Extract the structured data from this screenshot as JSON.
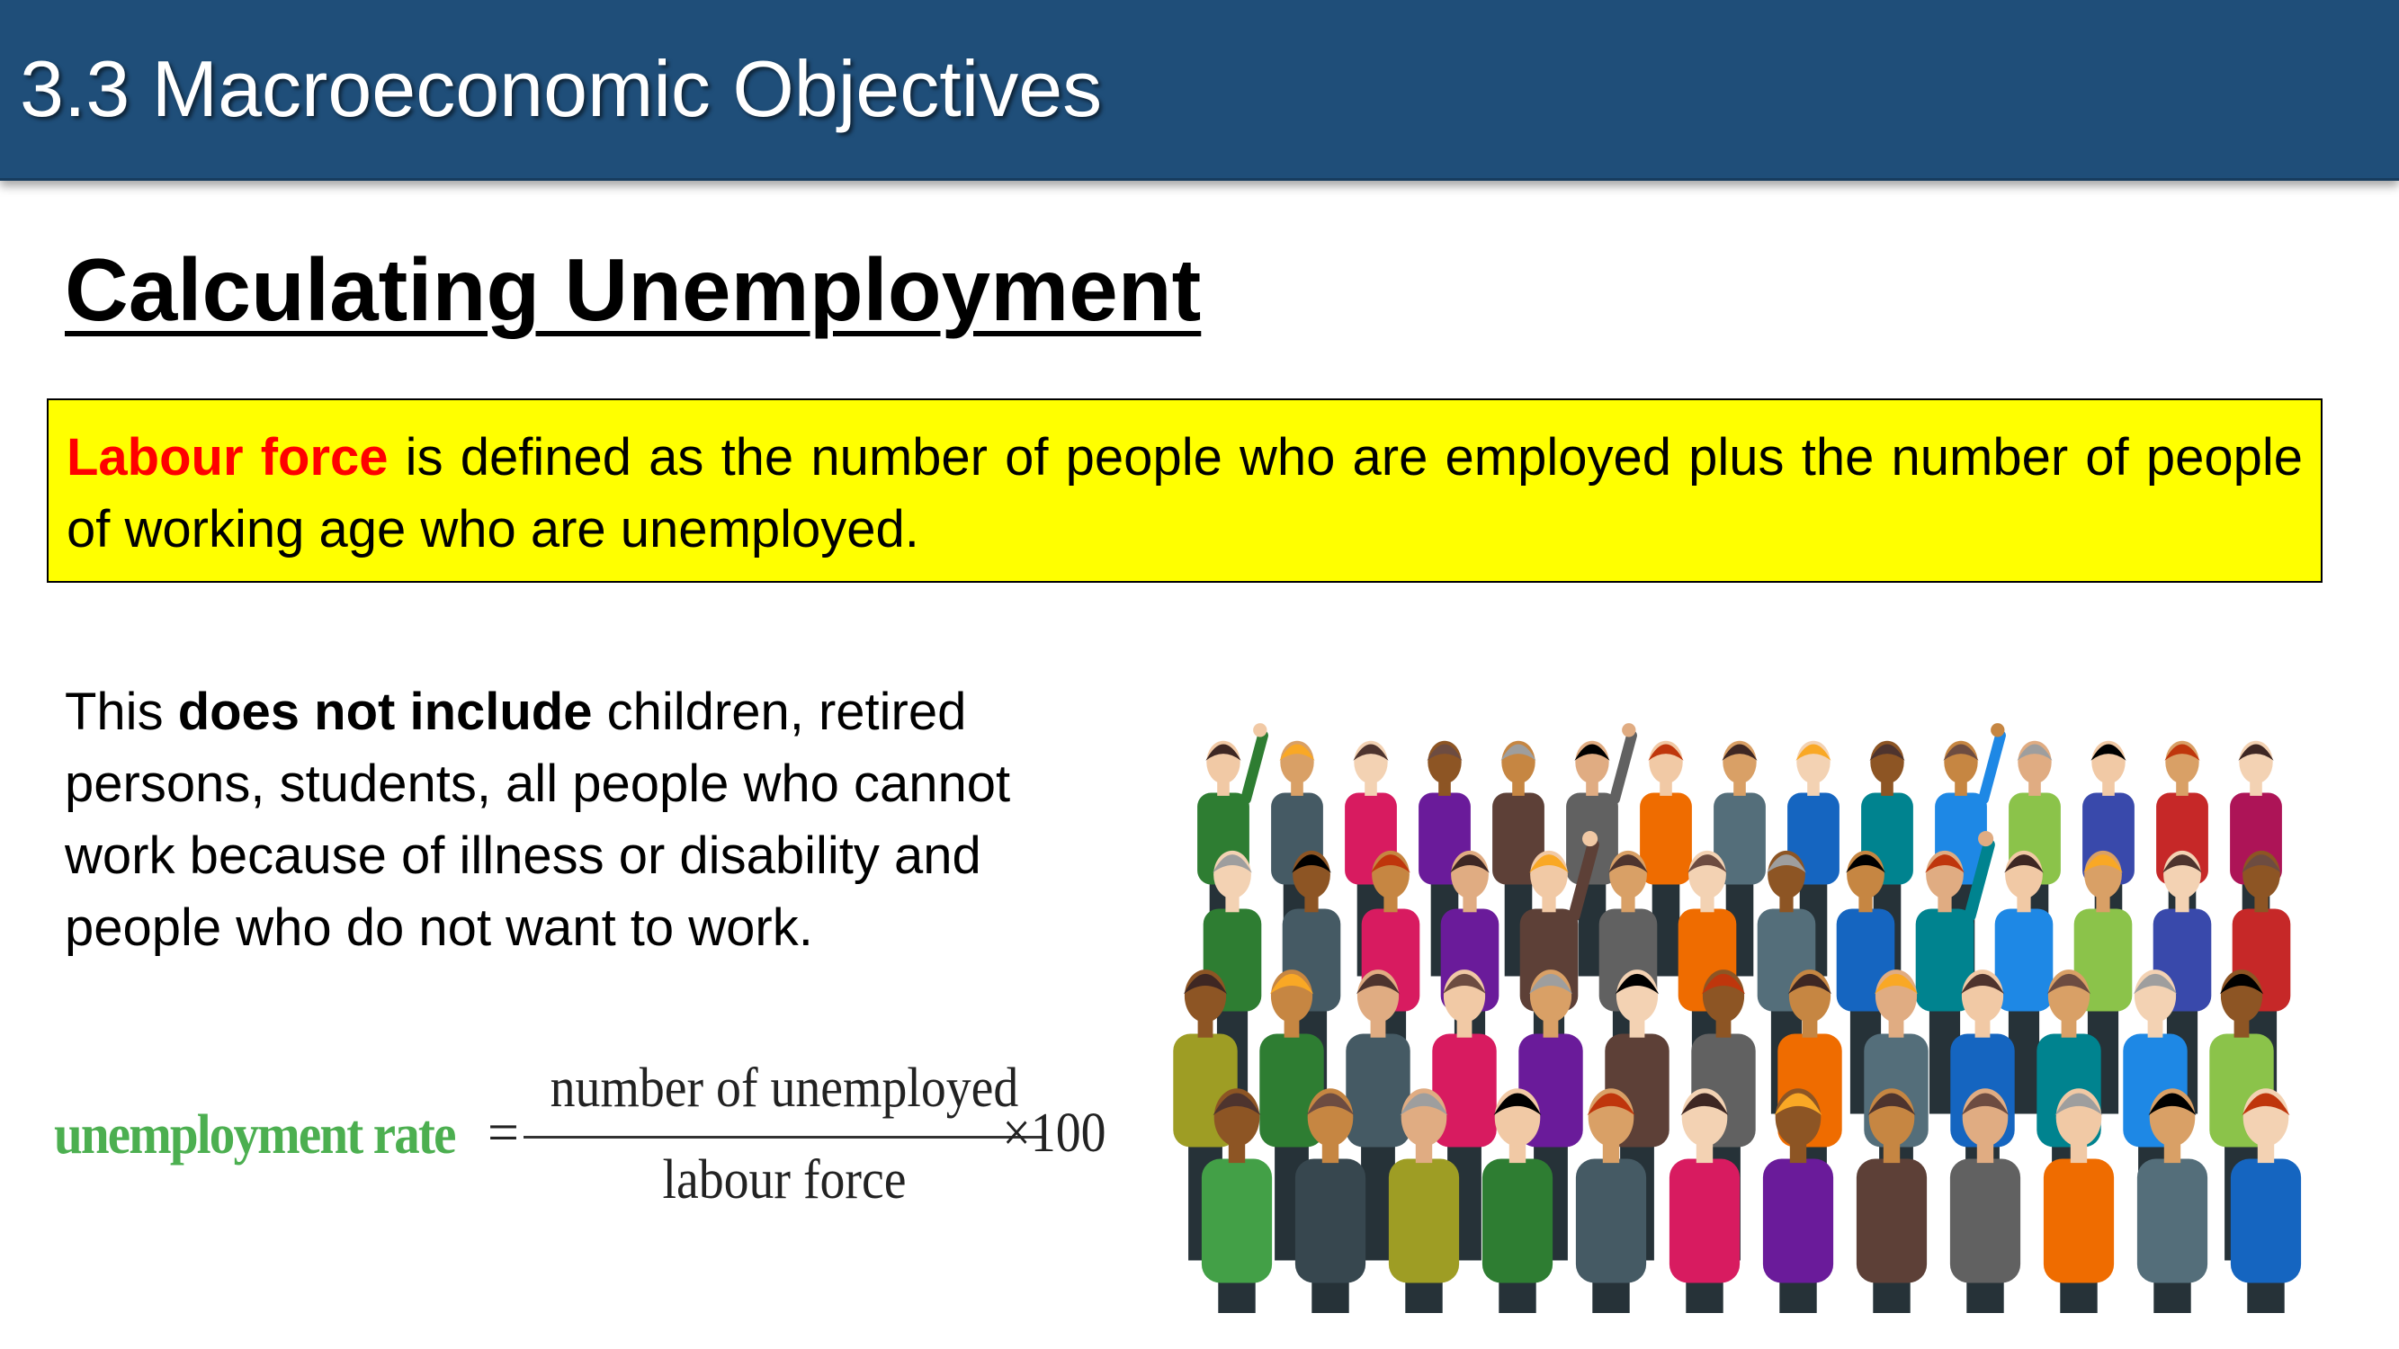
{
  "header": {
    "title": "3.3 Macroeconomic Objectives"
  },
  "heading": "Calculating Unemployment",
  "definition": {
    "term": "Labour force",
    "text": " is defined as the number of people who are employed plus the number of people of working age who are unemployed."
  },
  "paragraph": {
    "before": "This ",
    "bold": "does not include",
    "after": " children, retired persons, students, all people who cannot work because of illness or disability and people who do not want to work."
  },
  "formula": {
    "label": "unemployment rate",
    "equals": "=",
    "numerator": "number of unemployed",
    "denominator": "labour force",
    "multiplier": "×100"
  },
  "colors": {
    "header_bg": "#1f4e79",
    "definition_bg": "#ffff00",
    "term": "#ff0000",
    "formula_label": "#4caf50"
  },
  "image": {
    "icon": "crowd-of-people-illustration"
  }
}
